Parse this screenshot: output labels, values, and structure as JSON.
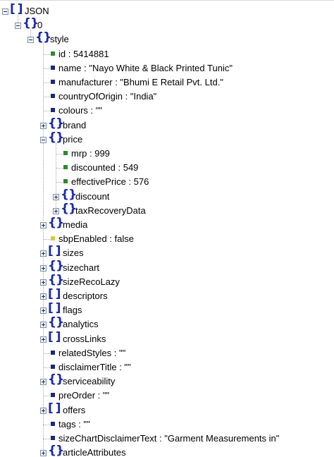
{
  "tree": {
    "rows": [
      {
        "depth": 0,
        "kind": "array",
        "toggle": "expanded",
        "text": "JSON",
        "icon": "bracket-icon"
      },
      {
        "depth": 1,
        "kind": "object",
        "toggle": "expanded",
        "text": "0",
        "icon": "brace-icon"
      },
      {
        "depth": 2,
        "kind": "object",
        "toggle": "expanded",
        "text": "style",
        "icon": "brace-icon"
      },
      {
        "depth": 3,
        "kind": "leaf",
        "type": "number",
        "text": "id : 5414881"
      },
      {
        "depth": 3,
        "kind": "leaf",
        "type": "string",
        "text": "name : \"Nayo White & Black Printed Tunic\""
      },
      {
        "depth": 3,
        "kind": "leaf",
        "type": "string",
        "text": "manufacturer : \"Bhumi E Retail Pvt. Ltd.\""
      },
      {
        "depth": 3,
        "kind": "leaf",
        "type": "string",
        "text": "countryOfOrigin : \"India\""
      },
      {
        "depth": 3,
        "kind": "leaf",
        "type": "string",
        "text": "colours : \"\""
      },
      {
        "depth": 3,
        "kind": "object",
        "toggle": "collapsed",
        "text": "brand",
        "icon": "brace-icon"
      },
      {
        "depth": 3,
        "kind": "object",
        "toggle": "expanded",
        "text": "price",
        "icon": "brace-icon"
      },
      {
        "depth": 4,
        "kind": "leaf",
        "type": "number",
        "text": "mrp : 999"
      },
      {
        "depth": 4,
        "kind": "leaf",
        "type": "number",
        "text": "discounted : 549"
      },
      {
        "depth": 4,
        "kind": "leaf",
        "type": "number",
        "text": "effectivePrice : 576"
      },
      {
        "depth": 4,
        "kind": "object",
        "toggle": "collapsed",
        "text": "discount",
        "icon": "brace-icon"
      },
      {
        "depth": 4,
        "kind": "object",
        "toggle": "collapsed",
        "text": "taxRecoveryData",
        "icon": "brace-icon"
      },
      {
        "depth": 3,
        "kind": "object",
        "toggle": "collapsed",
        "text": "media",
        "icon": "brace-icon"
      },
      {
        "depth": 3,
        "kind": "leaf",
        "type": "bool",
        "text": "sbpEnabled : false"
      },
      {
        "depth": 3,
        "kind": "array",
        "toggle": "collapsed",
        "text": "sizes",
        "icon": "bracket-icon"
      },
      {
        "depth": 3,
        "kind": "object",
        "toggle": "collapsed",
        "text": "sizechart",
        "icon": "brace-icon"
      },
      {
        "depth": 3,
        "kind": "object",
        "toggle": "collapsed",
        "text": "sizeRecoLazy",
        "icon": "brace-icon"
      },
      {
        "depth": 3,
        "kind": "array",
        "toggle": "collapsed",
        "text": "descriptors",
        "icon": "bracket-icon"
      },
      {
        "depth": 3,
        "kind": "array",
        "toggle": "collapsed",
        "text": "flags",
        "icon": "bracket-icon"
      },
      {
        "depth": 3,
        "kind": "object",
        "toggle": "collapsed",
        "text": "analytics",
        "icon": "brace-icon"
      },
      {
        "depth": 3,
        "kind": "array",
        "toggle": "collapsed",
        "text": "crossLinks",
        "icon": "bracket-icon"
      },
      {
        "depth": 3,
        "kind": "leaf",
        "type": "string",
        "text": "relatedStyles : \"\""
      },
      {
        "depth": 3,
        "kind": "leaf",
        "type": "string",
        "text": "disclaimerTitle : \"\""
      },
      {
        "depth": 3,
        "kind": "object",
        "toggle": "collapsed",
        "text": "serviceability",
        "icon": "brace-icon"
      },
      {
        "depth": 3,
        "kind": "leaf",
        "type": "string",
        "text": "preOrder : \"\""
      },
      {
        "depth": 3,
        "kind": "array",
        "toggle": "collapsed",
        "text": "offers",
        "icon": "bracket-icon"
      },
      {
        "depth": 3,
        "kind": "leaf",
        "type": "string",
        "text": "tags : \"\""
      },
      {
        "depth": 3,
        "kind": "leaf",
        "type": "string",
        "text": "sizeChartDisclaimerText : \"Garment Measurements in\""
      },
      {
        "depth": 3,
        "kind": "object",
        "toggle": "collapsed",
        "text": "articleAttributes",
        "icon": "brace-icon"
      }
    ]
  }
}
